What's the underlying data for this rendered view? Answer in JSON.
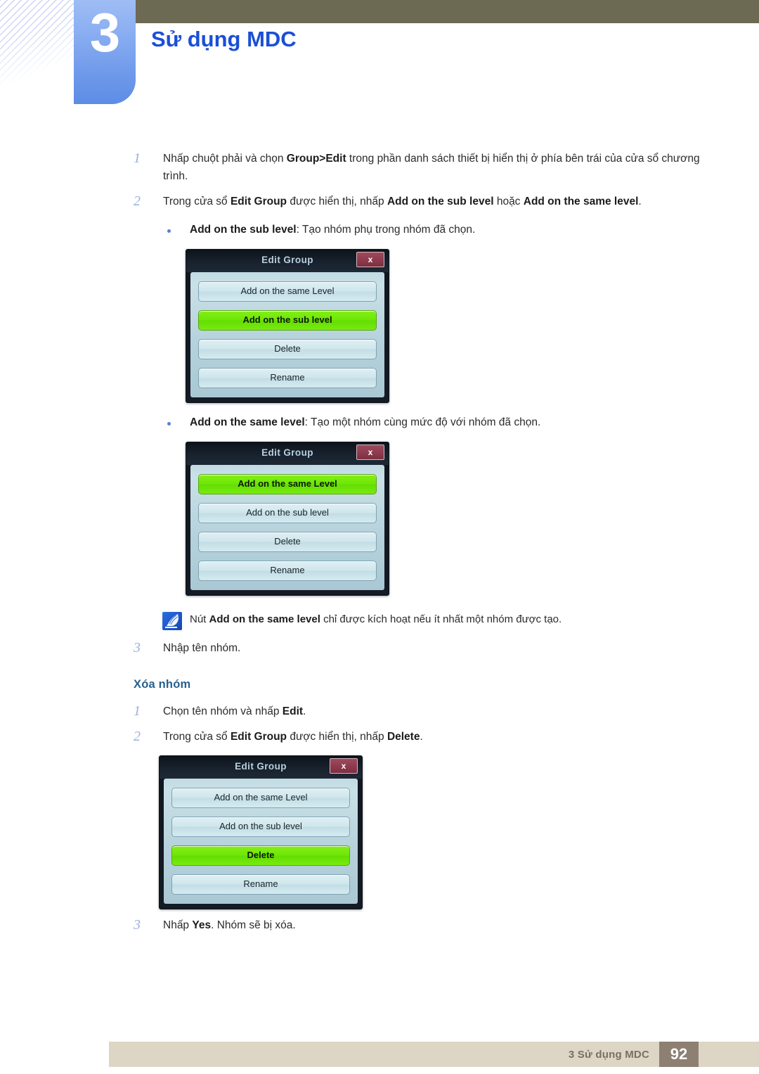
{
  "page": {
    "chapter_number": "3",
    "chapter_title": "Sử dụng MDC",
    "footer_text": "3 Sử dụng MDC",
    "page_number": "92",
    "colors": {
      "header_band": "#6d6a53",
      "chapter_tab": "#7ba3ef",
      "title_blue": "#1a4fd6",
      "subhead_blue": "#26608f",
      "footer_band": "#ddd6c5",
      "footer_page_box": "#8d7f72",
      "dialog_active_green": "#6fe606",
      "dialog_close_red": "#7d2f41"
    }
  },
  "steps": {
    "s1_num": "1",
    "s1_a": "Nhấp chuột phải và chọn ",
    "s1_b": "Group>Edit",
    "s1_c": " trong phần danh sách thiết bị hiển thị ở phía bên trái của cửa sổ chương trình.",
    "s2_num": "2",
    "s2_a": "Trong cửa sổ ",
    "s2_b": "Edit Group",
    "s2_c": " được hiển thị, nhấp ",
    "s2_d": "Add on the sub level",
    "s2_e": " hoặc ",
    "s2_f": "Add on the same level",
    "s2_g": ".",
    "bullet1_bold": "Add on the sub level",
    "bullet1_text": ": Tạo nhóm phụ trong nhóm đã chọn.",
    "bullet2_bold": "Add on the same level",
    "bullet2_text": ": Tạo một nhóm cùng mức độ với nhóm đã chọn.",
    "note_a": "Nút ",
    "note_b": "Add on the same level",
    "note_c": " chỉ được kích hoạt nếu ít nhất một nhóm được tạo.",
    "s3_num": "3",
    "s3_text": "Nhập tên nhóm."
  },
  "delete_section": {
    "heading": "Xóa nhóm",
    "d1_num": "1",
    "d1_a": "Chọn tên nhóm và nhấp ",
    "d1_b": "Edit",
    "d1_c": ".",
    "d2_num": "2",
    "d2_a": "Trong cửa sổ ",
    "d2_b": "Edit Group",
    "d2_c": " được hiển thị, nhấp ",
    "d2_d": "Delete",
    "d2_e": ".",
    "d3_num": "3",
    "d3_a": "Nhấp ",
    "d3_b": "Yes",
    "d3_c": ". Nhóm sẽ bị xóa."
  },
  "dialogs": [
    {
      "title": "Edit Group",
      "close_label": "x",
      "buttons": [
        {
          "label": "Add on the same Level",
          "active": false
        },
        {
          "label": "Add on the sub level",
          "active": true
        },
        {
          "label": "Delete",
          "active": false
        },
        {
          "label": "Rename",
          "active": false
        }
      ]
    },
    {
      "title": "Edit Group",
      "close_label": "x",
      "buttons": [
        {
          "label": "Add on the same Level",
          "active": true
        },
        {
          "label": "Add on the sub level",
          "active": false
        },
        {
          "label": "Delete",
          "active": false
        },
        {
          "label": "Rename",
          "active": false
        }
      ]
    },
    {
      "title": "Edit Group",
      "close_label": "x",
      "buttons": [
        {
          "label": "Add on the same Level",
          "active": false
        },
        {
          "label": "Add on the sub level",
          "active": false
        },
        {
          "label": "Delete",
          "active": true
        },
        {
          "label": "Rename",
          "active": false
        }
      ]
    }
  ]
}
